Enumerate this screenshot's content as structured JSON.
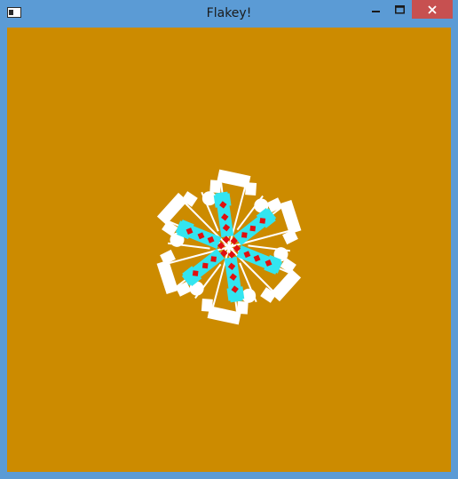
{
  "window": {
    "title": "Flakey!",
    "icons": {
      "app": "window-app-icon",
      "minimize": "minimize-icon",
      "maximize": "maximize-icon",
      "close": "close-icon"
    }
  },
  "colors": {
    "frame": "#5b9bd5",
    "canvas": "#cc8b00",
    "close": "#c75050",
    "flake_white": "#ffffff",
    "arm_cyan": "#33e5f0",
    "dot_red": "#e01010"
  },
  "snowflake": {
    "arm_count": 6
  }
}
